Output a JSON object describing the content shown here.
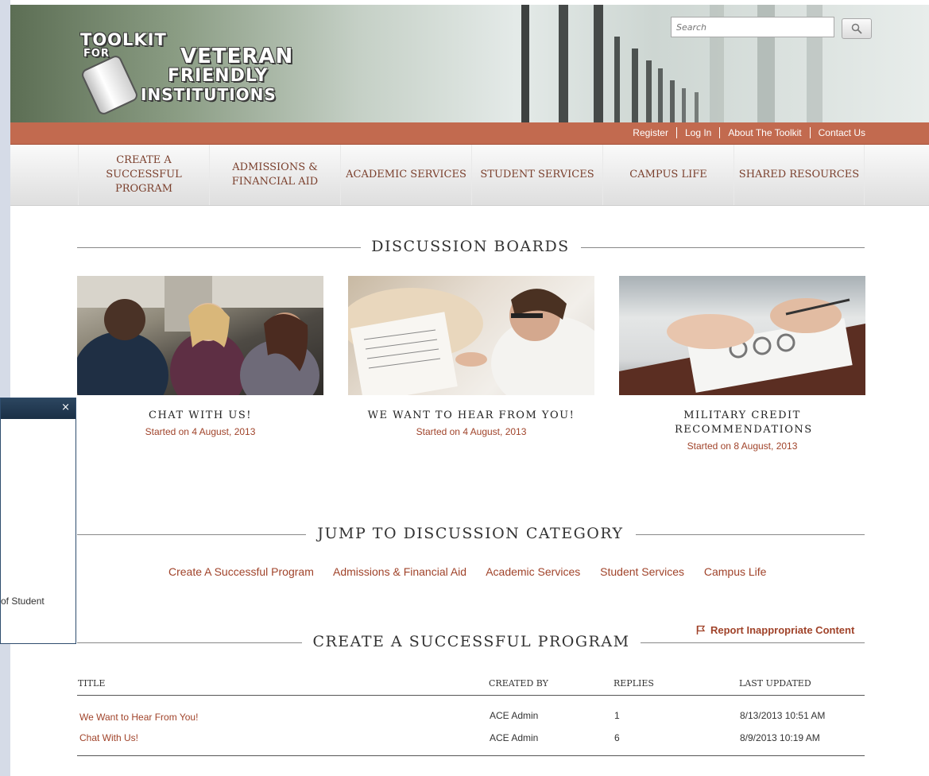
{
  "header": {
    "logo_line1": "TOOLKIT",
    "logo_line2": "FOR",
    "logo_line3": "VETERAN",
    "logo_line4": "FRIENDLY",
    "logo_line5": "INSTITUTIONS",
    "search_placeholder": "Search"
  },
  "top_links": [
    "Register",
    "Log In",
    "About The Toolkit",
    "Contact Us"
  ],
  "nav": [
    "CREATE A SUCCESSFUL PROGRAM",
    "ADMISSIONS & FINANCIAL AID",
    "ACADEMIC SERVICES",
    "STUDENT SERVICES",
    "CAMPUS LIFE",
    "SHARED RESOURCES"
  ],
  "discussion_boards": {
    "heading": "DISCUSSION BOARDS",
    "cards": [
      {
        "title": "CHAT WITH US!",
        "date": "Started on 4 August, 2013"
      },
      {
        "title": "WE WANT TO HEAR FROM YOU!",
        "date": "Started on 4 August, 2013"
      },
      {
        "title": "MILITARY CREDIT RECOMMENDATIONS",
        "date": "Started on 8 August, 2013"
      }
    ]
  },
  "jump": {
    "heading": "JUMP TO DISCUSSION CATEGORY",
    "links": [
      "Create A Successful Program",
      "Admissions & Financial Aid",
      "Academic Services",
      "Student Services",
      "Campus Life"
    ]
  },
  "report": "Report Inappropriate Content",
  "program": {
    "heading": "CREATE A SUCCESSFUL PROGRAM",
    "columns": [
      "TITLE",
      "CREATED BY",
      "REPLIES",
      "LAST UPDATED"
    ],
    "rows": [
      {
        "title": "We Want to Hear From You!",
        "created_by": "ACE Admin",
        "replies": "1",
        "last_updated": "8/13/2013 10:51 AM"
      },
      {
        "title": "Chat With Us!",
        "created_by": "ACE Admin",
        "replies": "6",
        "last_updated": "8/9/2013 10:19 AM"
      }
    ]
  },
  "dialog": {
    "close": "×",
    "fragment": "of Student"
  },
  "colors": {
    "accent": "#a0432a",
    "bar": "#c26a4f",
    "nav_text": "#7a3f2c"
  }
}
